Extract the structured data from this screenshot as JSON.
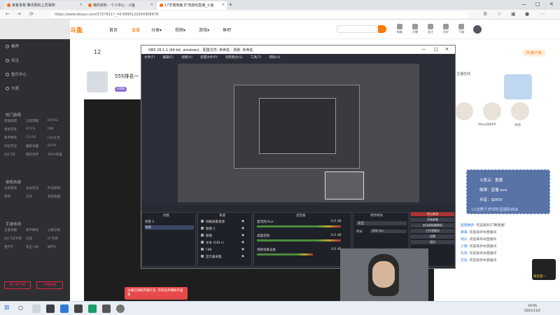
{
  "browser": {
    "tabs": [
      {
        "title": "来鲁事称 腾讯网的上同事称"
      },
      {
        "title": "我的资料 - 个人中心 - 斗鱼"
      },
      {
        "title": "17岁赛英雇,旷地游戏直播_斗鱼"
      }
    ],
    "new_tab": "+",
    "url": "https://www.douyu.com/5727911?_=0.6895121634308479"
  },
  "site": {
    "logo": "斗鱼",
    "nav": [
      "首页",
      "直播",
      "分类▾",
      "视频▾",
      "游戏▾",
      "鱼吧"
    ],
    "header_icons": [
      "新能",
      "开播",
      "关注",
      "历史",
      "下载",
      "消息"
    ]
  },
  "sidebar": {
    "items": [
      "推荐",
      "关注",
      "鱼乐中心",
      "分类"
    ],
    "sections": [
      {
        "title": "热门游戏",
        "items": [
          "英雄联盟",
          "王者荣耀",
          "DOTA2",
          "绝地求生",
          "CF/CS",
          "DNF",
          "和平精英",
          "CS:GO",
          "LOL云顶",
          "炉石传说",
          "魔兽争霸",
          "DOTA",
          "QQ飞车",
          "我的世界",
          "APEX英雄"
        ]
      },
      {
        "title": "单机热游",
        "items": [
          "主机游戏",
          "永劫无间",
          "怀旧游戏",
          "原神",
          "方舟",
          "星际争霸"
        ]
      },
      {
        "title": "手游休闲",
        "items": [
          "王者荣耀",
          "和平精英",
          "火影忍者",
          "QQ飞车手游",
          "问道",
          "CF手游",
          "金铲铲",
          "第五人格",
          "崩坏3"
        ]
      }
    ],
    "bottom_buttons": [
      "客户端下载",
      "开播秘籍"
    ]
  },
  "room": {
    "follow_count": "12",
    "streamer_name": "555排名一",
    "level": "LV88",
    "pc_badge": "PC客户端"
  },
  "obs": {
    "title": "OBS 26.1.1 (64-bit, windows) - 配置文件: 未命名 - 场景: 未命名",
    "menu": [
      "文件(F)",
      "编辑(E)",
      "视图(V)",
      "配置文件(P)",
      "场景集合(S)",
      "工具(T)",
      "帮助(H)"
    ],
    "docks": {
      "scenes": {
        "header": "场景",
        "items": [
          "场景 2",
          "场景"
        ]
      },
      "sources": {
        "header": "来源",
        "items": [
          "绿箱采集来源",
          "图像 2",
          "图像",
          "文本 (GDI+)",
          "FBK",
          "显示器采集"
        ]
      },
      "mixer": {
        "header": "混音器",
        "channels": [
          {
            "name": "麦克风/Aux",
            "db": "0.0 dB"
          },
          {
            "name": "桌面音频",
            "db": "0.0 dB"
          },
          {
            "name": "视频采集设备",
            "db": "0.0 dB"
          }
        ]
      },
      "transitions": {
        "header": "转场特效",
        "type": "淡出",
        "duration_label": "时长",
        "duration": "300 ms"
      },
      "controls": {
        "header": "控件",
        "buttons": [
          "停止推流",
          "开始录制",
          "启动虚拟摄像机",
          "工作室模式",
          "设置",
          "退出"
        ]
      }
    },
    "scene_list_label": "未选择源",
    "properties_label": "属性",
    "filters_label": "滤镜"
  },
  "chat": {
    "overlay": [
      {
        "label": "斗鱼云",
        "value": "重播"
      },
      {
        "label": "微博",
        "value": "直播 ovo"
      },
      {
        "label": "抖音",
        "value": "SJ959"
      }
    ],
    "overlay_footer": "11龙腾子虎领粉直播新自由",
    "messages": [
      {
        "user": "超管精灵",
        "text": ": 欢迎来到17黄直播!"
      },
      {
        "user": "某某",
        "text": ": 欢迎来到本直播间"
      },
      {
        "user": "观众",
        "text": ": 欢迎来到本直播间"
      },
      {
        "user": "小雨",
        "text": ": 欢迎来到本直播间"
      },
      {
        "user": "北风",
        "text": ": 欢迎来到本直播间"
      },
      {
        "user": "无名",
        "text": ": 欢迎来到本直播间"
      }
    ],
    "rank_badge": "排名第一",
    "recommend": [
      "主播在线",
      "MasaQWER",
      "吊饰"
    ]
  },
  "notification": "主播已领取开播礼包, 可前往开播助手查看",
  "taskbar": {
    "time": "19:05",
    "date": "2021/11/2"
  },
  "colors": {
    "accent": "#f70",
    "obs_bg": "#2b2e38",
    "sidebar_bg": "#2e2f33",
    "stop_btn": "#a33"
  }
}
